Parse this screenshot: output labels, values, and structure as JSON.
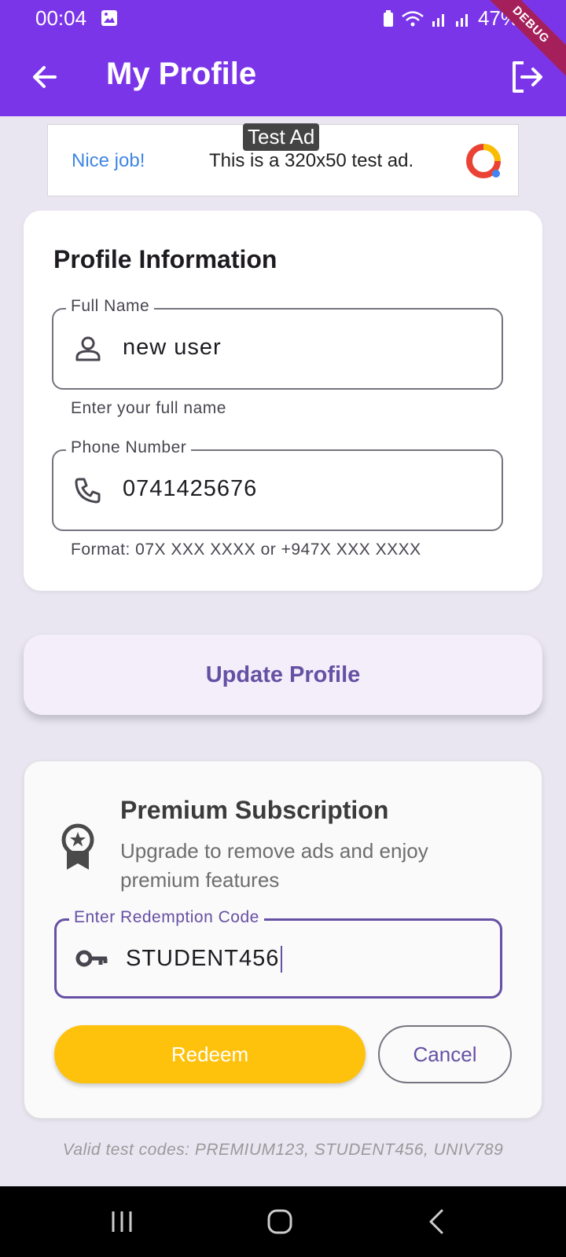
{
  "status": {
    "time": "00:04",
    "battery": "47%",
    "debug": "DEBUG"
  },
  "appbar": {
    "title": "My Profile"
  },
  "ad": {
    "tag": "Test Ad",
    "nice": "Nice job!",
    "text": "This is a 320x50 test ad."
  },
  "profile": {
    "title": "Profile Information",
    "full_name": {
      "label": "Full Name",
      "value": "new user",
      "helper": "Enter your full name"
    },
    "phone": {
      "label": "Phone Number",
      "value": "0741425676",
      "helper": "Format: 07X XXX XXXX or +947X XXX XXXX"
    }
  },
  "update_button": "Update Profile",
  "premium": {
    "title": "Premium Subscription",
    "description": "Upgrade to remove ads and enjoy premium features",
    "code_field": {
      "label": "Enter Redemption Code",
      "value": "STUDENT456"
    },
    "redeem": "Redeem",
    "cancel": "Cancel"
  },
  "test_codes": "Valid test codes: PREMIUM123, STUDENT456, UNIV789",
  "colors": {
    "primary": "#7b35e8",
    "accent": "#6650a4",
    "redeem": "#fec10c"
  }
}
